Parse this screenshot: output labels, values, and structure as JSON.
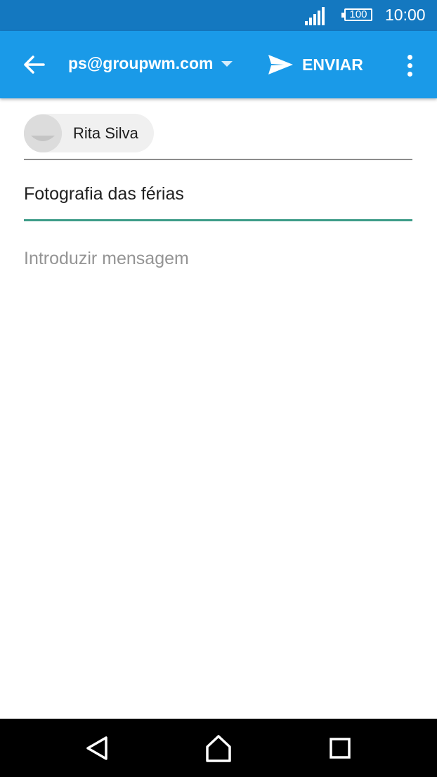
{
  "status_bar": {
    "battery_level": "100",
    "time": "10:00",
    "signal_icon": "signal-icon",
    "battery_icon": "battery-icon"
  },
  "toolbar": {
    "back_icon": "arrow-back-icon",
    "account": "ps@groupwm.com",
    "account_dropdown_icon": "caret-down-icon",
    "send_icon": "send-icon",
    "send_label": "ENVIAR",
    "more_icon": "more-vert-icon"
  },
  "compose": {
    "recipient": {
      "name": "Rita Silva",
      "avatar_icon": "contact-avatar-icon"
    },
    "subject_value": "Fotografia das férias",
    "body_placeholder": "Introduzir mensagem"
  },
  "nav_bar": {
    "back_icon": "nav-back-icon",
    "home_icon": "nav-home-icon",
    "recents_icon": "nav-recents-icon"
  },
  "colors": {
    "status_bar": "#1478c0",
    "toolbar": "#1a9ae8",
    "subject_underline": "#3d9c88",
    "placeholder_text": "#949494"
  }
}
